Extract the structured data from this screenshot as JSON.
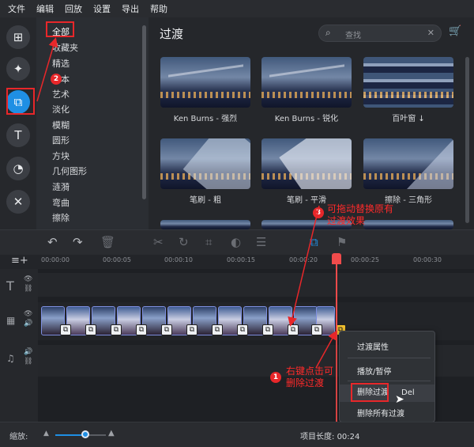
{
  "menu": [
    "文件",
    "编辑",
    "回放",
    "设置",
    "导出",
    "帮助"
  ],
  "categories": [
    "全部",
    "收藏夹",
    "精选",
    "基本",
    "艺术",
    "淡化",
    "模糊",
    "圆形",
    "方块",
    "几何图形",
    "涟漪",
    "弯曲",
    "擦除"
  ],
  "selected_category": "全部",
  "panel": {
    "title": "过渡",
    "search_placeholder": "查找"
  },
  "transitions": [
    {
      "label": "Ken Burns - 强烈",
      "style": "plain"
    },
    {
      "label": "Ken Burns - 锐化",
      "style": "plain"
    },
    {
      "label": "百叶窗 ↓",
      "style": "blinds"
    },
    {
      "label": "笔刷 - 粗",
      "style": "brush"
    },
    {
      "label": "笔刷 - 平滑",
      "style": "brush2"
    },
    {
      "label": "擦除 - 三角形",
      "style": "tri"
    }
  ],
  "ruler_ticks": [
    "00:00:00",
    "00:00:05",
    "00:00:10",
    "00:00:15",
    "00:00:20",
    "00:00:25",
    "00:00:30"
  ],
  "context_menu": {
    "items": [
      "过渡属性",
      "播放/暂停",
      "删除过渡",
      "删除所有过渡"
    ],
    "shortcut": "Del",
    "highlighted": "删除过渡"
  },
  "bottom": {
    "zoom_label": "缩放:",
    "zoom_level": 0.6,
    "project_length_label": "项目长度:",
    "project_length": "00:24"
  },
  "annotations": {
    "n1": "1",
    "n2": "2",
    "n3": "3",
    "text1": "右键点击可\n删除过渡",
    "text3": "可拖动替换原有\n过渡效果"
  },
  "colors": {
    "accent": "#1f8fe4",
    "annotation_red": "#e8272a",
    "playhead": "#f04b4b"
  }
}
